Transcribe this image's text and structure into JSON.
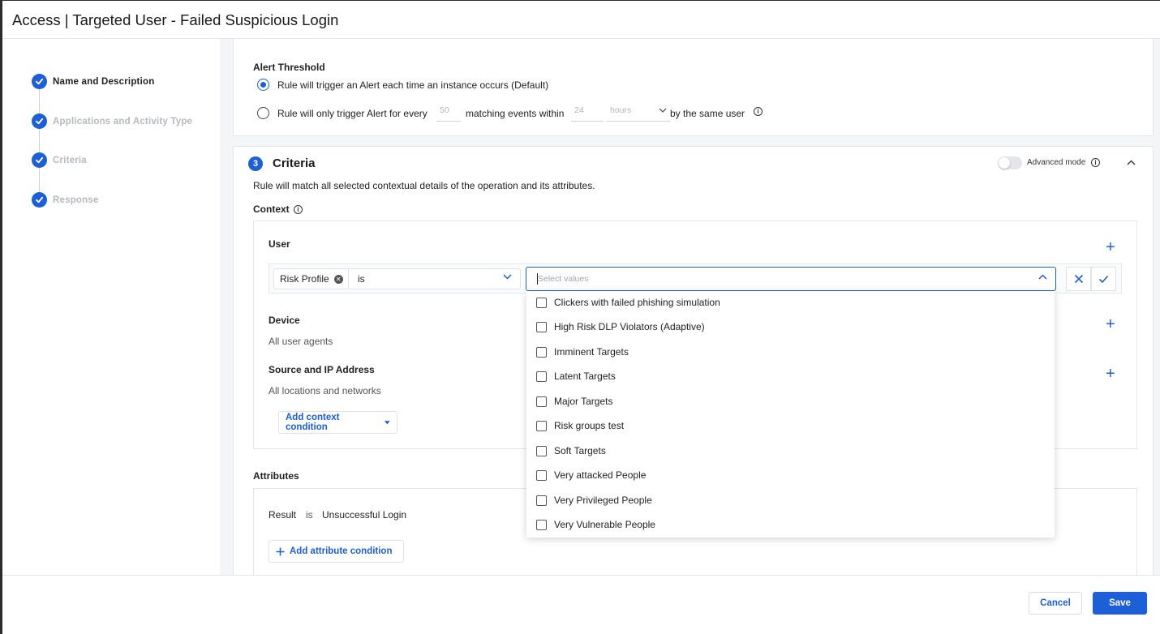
{
  "page": {
    "title": "Access | Targeted User - Failed Suspicious Login"
  },
  "stepper": {
    "steps": [
      {
        "label": "Name and Description",
        "state": "completed-active"
      },
      {
        "label": "Applications and Activity Type",
        "state": "completed"
      },
      {
        "label": "Criteria",
        "state": "completed"
      },
      {
        "label": "Response",
        "state": "completed"
      }
    ]
  },
  "alert_threshold": {
    "label": "Alert Threshold",
    "option_default": "Rule will trigger an Alert each time an instance occurs (Default)",
    "option_custom_prefix": "Rule will only trigger Alert for every",
    "events_placeholder": "50",
    "option_custom_middle": "matching events within",
    "time_placeholder": "24",
    "unit_placeholder": "hours",
    "option_custom_suffix": "by the same user"
  },
  "criteria": {
    "step_number": "3",
    "title": "Criteria",
    "advanced_mode_label": "Advanced mode",
    "description": "Rule will match all selected contextual details of the operation and its attributes.",
    "context_label": "Context",
    "user": {
      "label": "User",
      "condition_field": "Risk Profile",
      "condition_operator": "is",
      "values_placeholder": "Select values"
    },
    "device": {
      "label": "Device",
      "value": "All user agents"
    },
    "source": {
      "label": "Source and IP Address",
      "value": "All locations and networks"
    },
    "add_context_label": "Add context condition",
    "attributes": {
      "label": "Attributes",
      "field": "Result",
      "operator": "is",
      "value": "Unsuccessful Login",
      "add_attribute_label": "Add attribute condition"
    }
  },
  "dropdown": {
    "options": [
      "Clickers with failed phishing simulation",
      "High Risk DLP Violators (Adaptive)",
      "Imminent Targets",
      "Latent Targets",
      "Major Targets",
      "Risk groups test",
      "Soft Targets",
      "Very attacked People",
      "Very Privileged People",
      "Very Vulnerable People"
    ]
  },
  "footer": {
    "cancel_label": "Cancel",
    "save_label": "Save"
  },
  "colors": {
    "accent": "#1d5fd6",
    "muted_text": "#b6b9be",
    "panel_bg": "#f4f5f7"
  }
}
